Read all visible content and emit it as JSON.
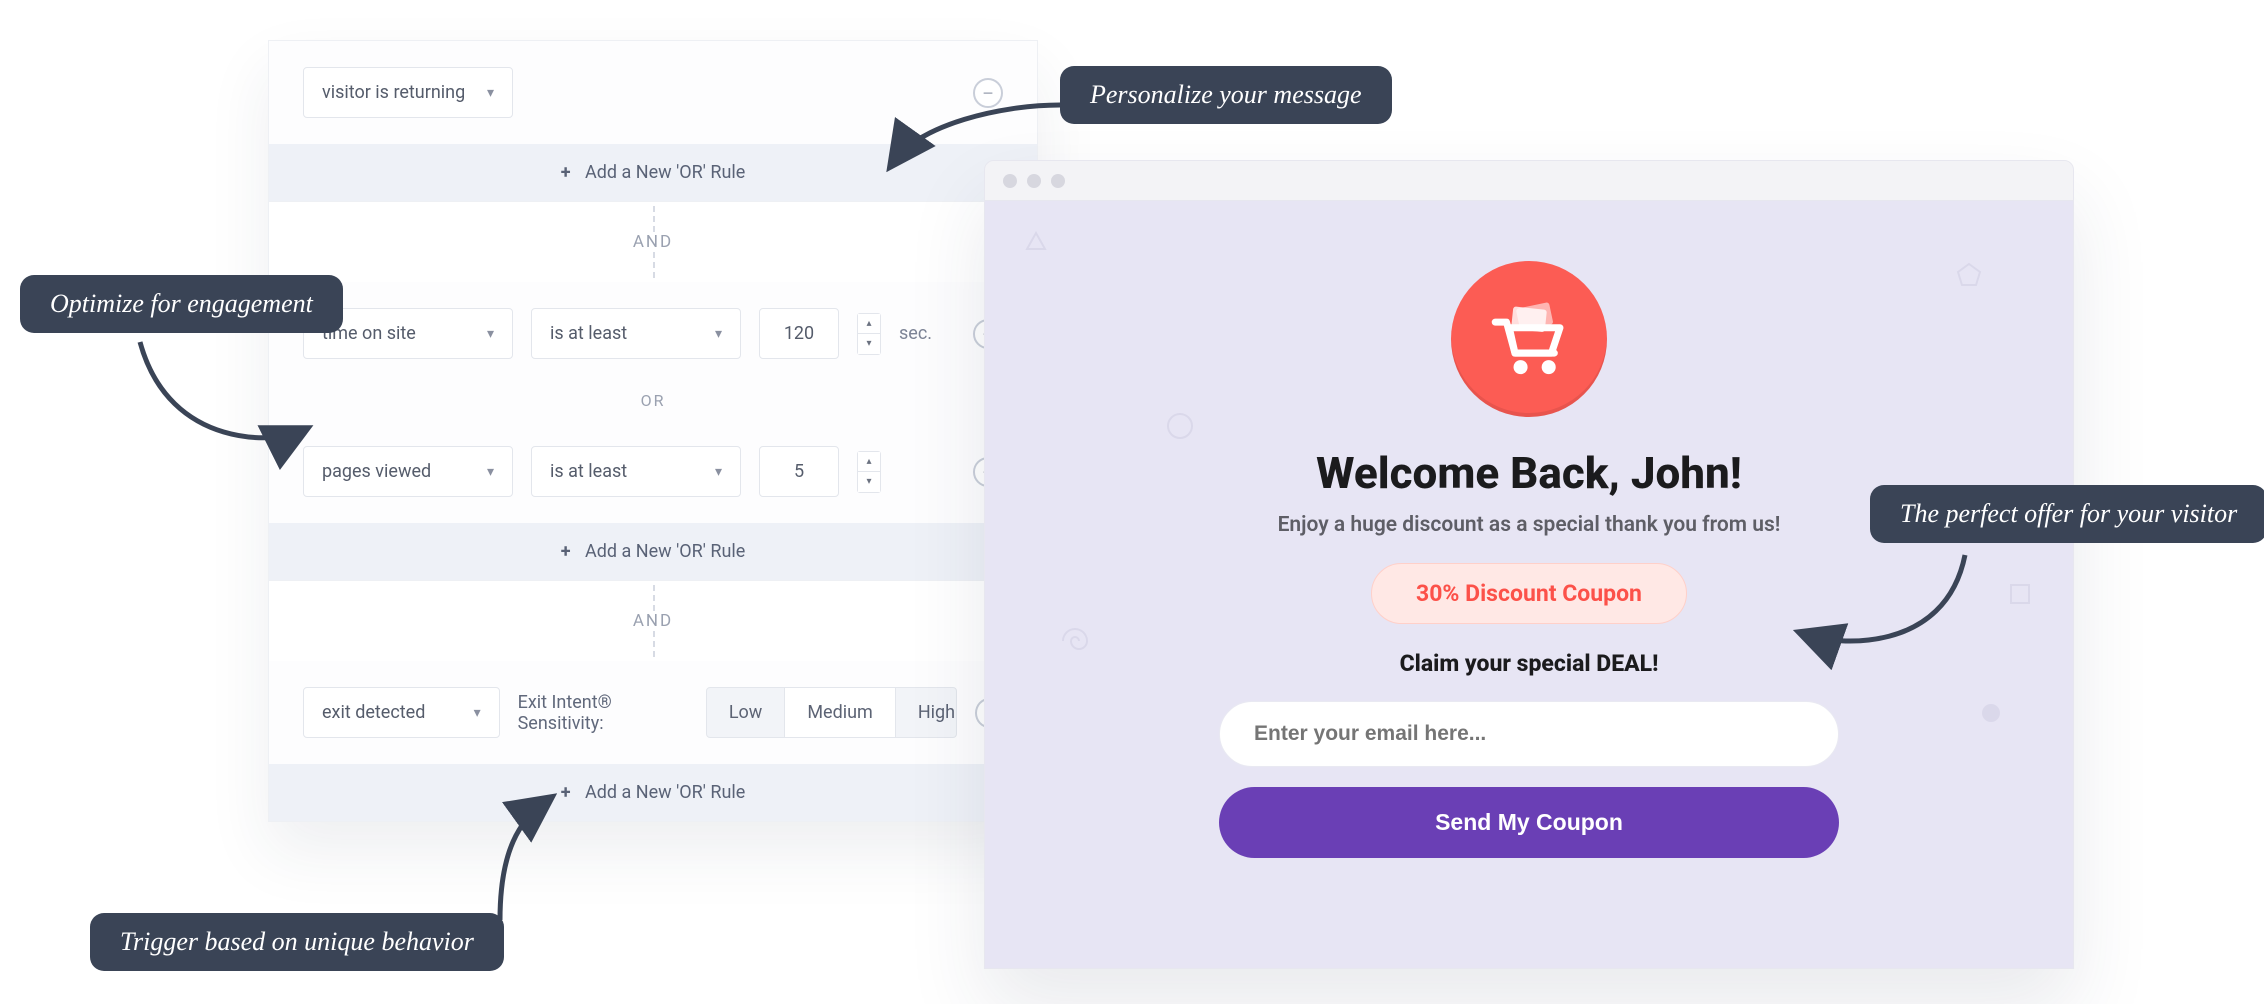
{
  "rules": {
    "group1": {
      "rule1": {
        "field": "visitor is returning"
      },
      "add_or": "Add a New 'OR' Rule"
    },
    "and_label": "AND",
    "or_label": "OR",
    "group2": {
      "rule1": {
        "field": "time on site",
        "op": "is at least",
        "value": "120",
        "suffix": "sec."
      },
      "rule2": {
        "field": "pages viewed",
        "op": "is at least",
        "value": "5"
      },
      "add_or": "Add a New 'OR' Rule"
    },
    "group3": {
      "rule1": {
        "field": "exit detected",
        "sens_label": "Exit Intent® Sensitivity:",
        "opts": {
          "low": "Low",
          "med": "Medium",
          "high": "High"
        }
      },
      "add_or": "Add a New 'OR' Rule"
    }
  },
  "preview": {
    "heading": "Welcome Back, John!",
    "subheading": "Enjoy a huge discount as a special thank you from us!",
    "coupon": "30% Discount Coupon",
    "claim": "Claim your special DEAL!",
    "placeholder": "Enter your email here...",
    "button": "Send My Coupon"
  },
  "callouts": {
    "optimize": "Optimize for engagement",
    "personalize": "Personalize your message",
    "trigger": "Trigger based on unique behavior",
    "offer": "The perfect offer for your visitor"
  },
  "icons": {
    "cart": "cart-icon"
  }
}
